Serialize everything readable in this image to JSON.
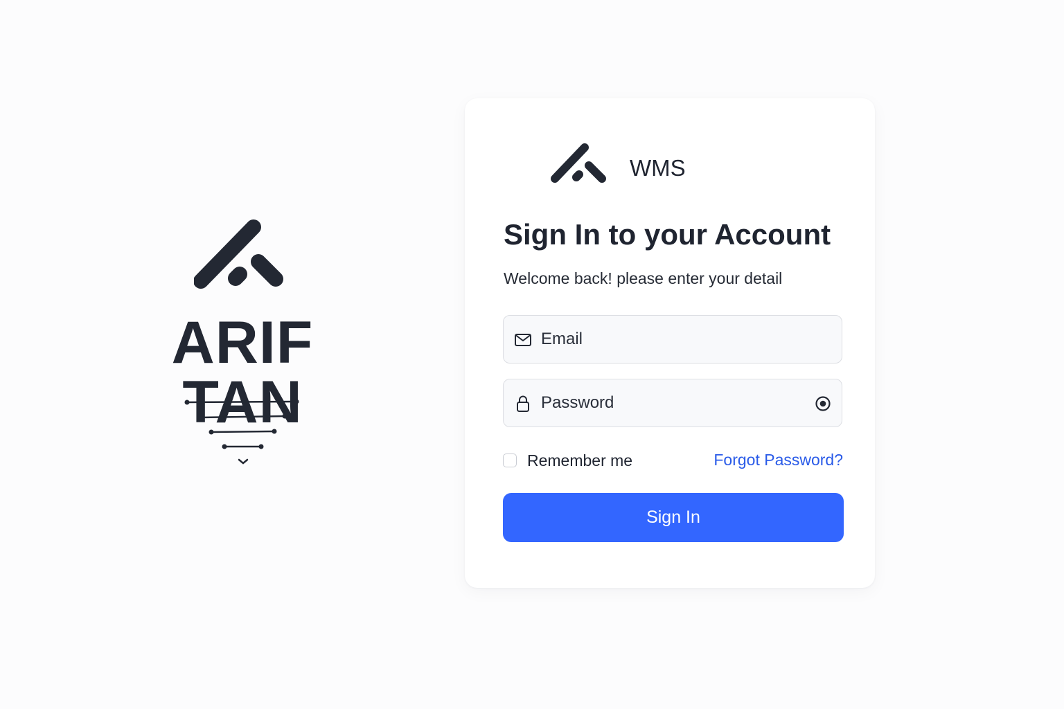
{
  "brand": {
    "name": "ARIF TAN",
    "logo_icon": "arrow-roof-logo-icon",
    "mark_icon": "stacked-lines-funnel-icon"
  },
  "card": {
    "logo_icon": "arrow-roof-logo-icon",
    "app_name": "WMS",
    "title": "Sign In to your Account",
    "subtitle": "Welcome back! please enter your detail"
  },
  "form": {
    "email": {
      "placeholder": "Email",
      "value": "",
      "icon": "mail-icon"
    },
    "password": {
      "placeholder": "Password",
      "value": "",
      "icon": "lock-icon",
      "toggle_icon": "eye-icon"
    },
    "remember_label": "Remember me",
    "remember_checked": false,
    "forgot_label": "Forgot Password?",
    "submit_label": "Sign In"
  },
  "colors": {
    "primary": "#3366ff",
    "link": "#2a5be8",
    "text": "#1f2430",
    "background": "#fcfcfd",
    "input_background": "#f8f9fb",
    "input_border": "#dcdee3"
  }
}
